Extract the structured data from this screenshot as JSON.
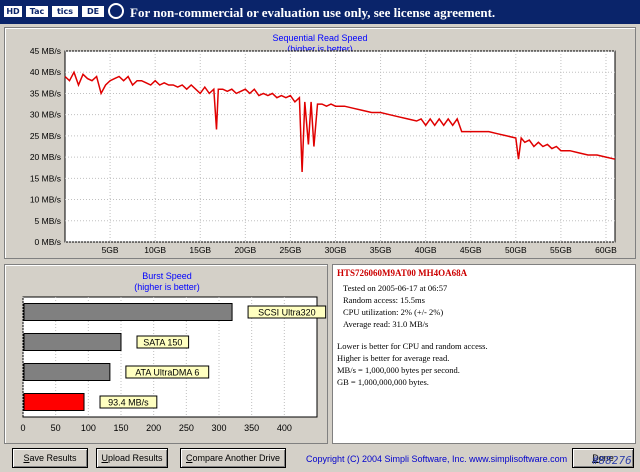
{
  "titlebar": {
    "logo_letters": [
      "HD",
      "Tac",
      "tics",
      "DE"
    ],
    "notice": "For non-commercial or evaluation use only, see license agreement."
  },
  "read_chart": {
    "title_line1": "Sequential Read Speed",
    "title_line2": "(higher is better)"
  },
  "burst_chart": {
    "title_line1": "Burst Speed",
    "title_line2": "(higher is better)"
  },
  "chart_data": [
    {
      "type": "line",
      "title": "Sequential Read Speed",
      "subtitle": "(higher is better)",
      "xlim": [
        0,
        61
      ],
      "ylim": [
        0,
        45
      ],
      "x_ticks": [
        "5GB",
        "10GB",
        "15GB",
        "20GB",
        "25GB",
        "30GB",
        "35GB",
        "40GB",
        "45GB",
        "50GB",
        "55GB",
        "60GB"
      ],
      "y_ticks": [
        "0 MB/s",
        "5 MB/s",
        "10 MB/s",
        "15 MB/s",
        "20 MB/s",
        "25 MB/s",
        "30 MB/s",
        "35 MB/s",
        "40 MB/s",
        "45 MB/s"
      ],
      "grid": true,
      "color": "#e00000",
      "series": [
        {
          "x": [
            0,
            0.5,
            1,
            1.5,
            2,
            2.5,
            3,
            3.5,
            4,
            4.5,
            5,
            5.5,
            6,
            6.5,
            7,
            7.5,
            8,
            8.5,
            9,
            9.5,
            10,
            10.5,
            11,
            11.5,
            12,
            12.5,
            13,
            13.5,
            14,
            14.5,
            15,
            15.5,
            16,
            16.5,
            16.8,
            17,
            17.5,
            18,
            18.5,
            19,
            19.5,
            20,
            20.5,
            21,
            21.5,
            22,
            22.5,
            23,
            23.5,
            24,
            24.5,
            25,
            25.5,
            26,
            26.3,
            26.6,
            27,
            27.3,
            27.6,
            28,
            28.5,
            29,
            29.5,
            30,
            31,
            32,
            33,
            34,
            35,
            36,
            37,
            38,
            39,
            39.5,
            40,
            40.5,
            41,
            41.5,
            42,
            42.5,
            43,
            43.5,
            44,
            44.5,
            45,
            46,
            47,
            48,
            49,
            50,
            50.3,
            50.6,
            51,
            51.5,
            52,
            52.5,
            53,
            53.5,
            54,
            54.5,
            55,
            56,
            57,
            58,
            59,
            60,
            61
          ],
          "y": [
            39,
            38,
            40,
            37,
            39.5,
            38.5,
            38,
            39,
            35,
            37,
            38,
            38.5,
            39,
            38,
            39,
            37,
            38,
            38,
            37.5,
            37,
            38,
            37,
            37.5,
            37,
            37,
            36.5,
            37,
            36,
            37,
            36,
            35,
            36.5,
            35,
            36,
            26.5,
            36,
            36,
            35.5,
            36,
            35,
            35.5,
            36,
            35,
            36,
            34.5,
            35,
            34.5,
            35,
            34,
            34.5,
            34,
            34.5,
            33,
            34,
            16.5,
            33,
            23,
            33,
            22.5,
            32.5,
            32.5,
            32,
            32.5,
            32,
            32,
            31.5,
            31,
            30.5,
            30.5,
            30,
            29.5,
            29,
            28.5,
            29,
            27.5,
            29,
            27.5,
            29,
            27.5,
            29,
            27.5,
            29,
            26,
            26,
            26,
            26,
            26,
            25.5,
            25,
            24.5,
            19.5,
            24.5,
            23.5,
            24,
            22.5,
            23.5,
            22.5,
            23,
            22,
            22.5,
            21.5,
            21.5,
            21,
            20.5,
            20.5,
            20,
            19.5
          ]
        }
      ]
    },
    {
      "type": "bar",
      "orientation": "horizontal",
      "title": "Burst Speed",
      "subtitle": "(higher is better)",
      "xlim": [
        0,
        450
      ],
      "x_ticks": [
        "0",
        "50",
        "100",
        "150",
        "200",
        "250",
        "300",
        "350",
        "400"
      ],
      "bars": [
        {
          "label": "SCSI Ultra320",
          "value": 320,
          "color": "#808080"
        },
        {
          "label": "SATA 150",
          "value": 150,
          "color": "#808080"
        },
        {
          "label": "ATA UltraDMA 6",
          "value": 133,
          "color": "#808080"
        },
        {
          "label": "93.4 MB/s",
          "value": 93.4,
          "color": "#ff0000"
        }
      ]
    }
  ],
  "info": {
    "drive_name": "HTS726060M9AT00 MH4OA68A",
    "lines": [
      "Tested on 2005-06-17 at 06:57",
      "Random access: 15.5ms",
      "CPU utilization: 2% (+/- 2%)",
      "Average read: 31.0 MB/s"
    ],
    "notes": [
      "Lower is better for CPU and random access.",
      "Higher is better for average read.",
      "MB/s = 1,000,000 bytes per second.",
      "GB = 1,000,000,000 bytes."
    ]
  },
  "buttons": {
    "save_first": "S",
    "save_rest": "ave Results",
    "upload_first": "U",
    "upload_rest": "pload Results",
    "compare_first": "C",
    "compare_rest": "ompare Another Drive",
    "done_first": "D",
    "done_rest": "one"
  },
  "footer": {
    "copyright": "Copyright (C) 2004 Simpli Software, Inc. www.simplisoftware.com",
    "watermark": "#88276"
  }
}
